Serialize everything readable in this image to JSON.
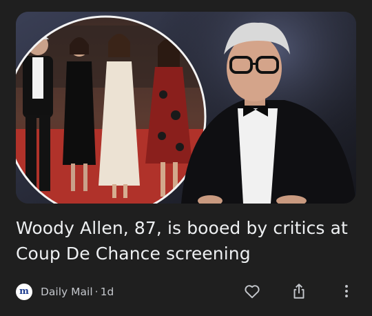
{
  "card": {
    "headline": "Woody Allen, 87, is booed by critics at Coup De Chance screening",
    "source": {
      "logo_letter": "m",
      "name": "Daily Mail",
      "separator": "·",
      "age": "1d"
    },
    "image": {
      "description_icon": "news-photo"
    },
    "actions": [
      {
        "name": "like",
        "icon": "heart-outline-icon"
      },
      {
        "name": "share",
        "icon": "share-icon"
      },
      {
        "name": "more",
        "icon": "more-vert-icon"
      }
    ]
  },
  "colors": {
    "background": "#1f1f1f",
    "text": "#eef0f2",
    "secondary_text": "#c4c7cc",
    "source_logo": "#1a3a8f"
  }
}
